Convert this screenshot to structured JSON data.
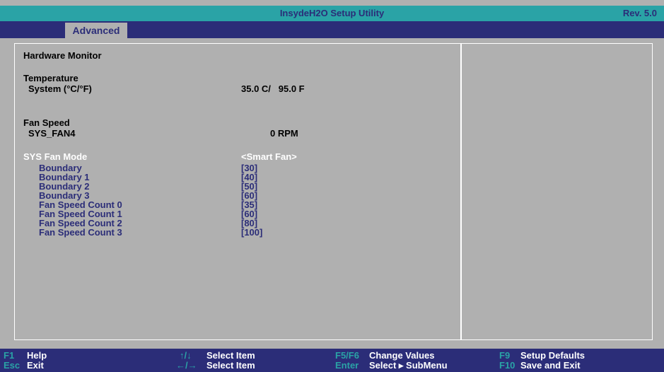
{
  "header": {
    "title": "InsydeH2O Setup Utility",
    "rev": "Rev. 5.0"
  },
  "tabs": [
    {
      "label": "Advanced"
    }
  ],
  "page": {
    "heading": "Hardware Monitor",
    "temperature_section": "Temperature",
    "system_temp_label": "System (°C/°F)",
    "system_temp_value": "35.0 C/   95.0 F",
    "fan_speed_section": "Fan Speed",
    "sys_fan4_label": "SYS_FAN4",
    "sys_fan4_value": "0 RPM",
    "sys_fan_mode_label": "SYS Fan Mode",
    "sys_fan_mode_value": "<Smart Fan>",
    "settings": [
      {
        "label": "Boundary",
        "value": "[30]"
      },
      {
        "label": "Boundary 1",
        "value": "[40]"
      },
      {
        "label": "Boundary 2",
        "value": "[50]"
      },
      {
        "label": "Boundary 3",
        "value": "[60]"
      },
      {
        "label": "Fan Speed Count 0",
        "value": "[35]"
      },
      {
        "label": "Fan Speed Count 1",
        "value": "[60]"
      },
      {
        "label": "Fan Speed Count 2",
        "value": "[80]"
      },
      {
        "label": "Fan Speed Count 3",
        "value": "[100]"
      }
    ]
  },
  "footer": [
    {
      "key": "F1",
      "label": "Help"
    },
    {
      "key": "Esc",
      "label": "Exit"
    },
    {
      "key": "↑/↓",
      "label": "Select Item"
    },
    {
      "key": "←/→",
      "label": "Select Item"
    },
    {
      "key": "F5/F6",
      "label": "Change Values"
    },
    {
      "key": "Enter",
      "label": "Select ▸ SubMenu"
    },
    {
      "key": "F9",
      "label": "Setup Defaults"
    },
    {
      "key": "F10",
      "label": "Save and Exit"
    }
  ],
  "colors": {
    "teal": "#2aa3a6",
    "navy": "#2b2d78",
    "panel": "#b0b0b0",
    "selected": "#ffffff"
  }
}
